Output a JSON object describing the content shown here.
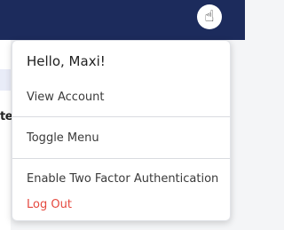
{
  "topbar": {
    "avatar_icon": "pointer-hand-icon",
    "avatar_glyph": "☝"
  },
  "background": {
    "truncated_text": "te"
  },
  "dropdown": {
    "greeting": "Hello, Maxi!",
    "items": {
      "view_account": "View Account",
      "toggle_menu": "Toggle Menu",
      "enable_2fa": "Enable Two Factor Authentication",
      "logout": "Log Out"
    }
  },
  "colors": {
    "topbar": "#1c2b5c",
    "logout": "#e5493f"
  }
}
